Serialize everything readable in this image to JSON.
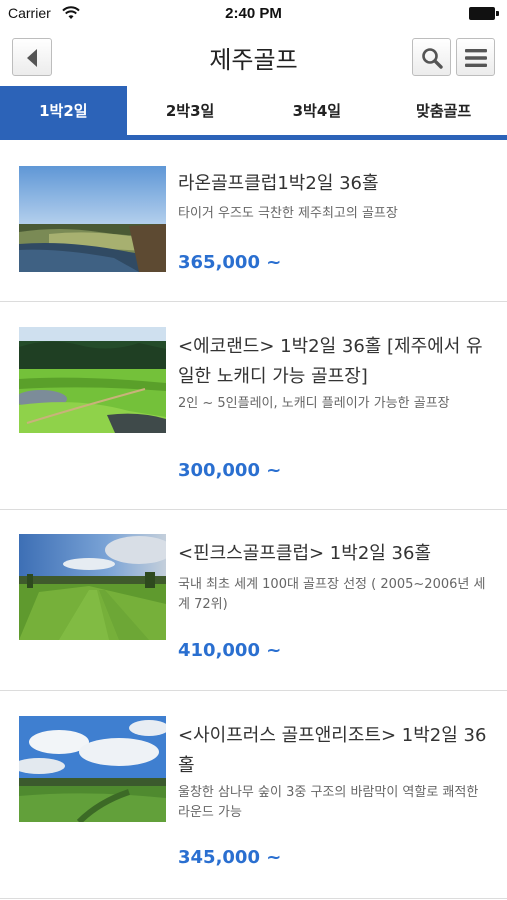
{
  "status_bar": {
    "carrier": "Carrier",
    "time": "2:40 PM"
  },
  "nav": {
    "title": "제주골프",
    "back_icon": "chevron-left-icon",
    "search_icon": "search-icon",
    "menu_icon": "hamburger-menu-icon"
  },
  "tabs": [
    {
      "label": "1박2일",
      "active": true
    },
    {
      "label": "2박3일",
      "active": false
    },
    {
      "label": "3박4일",
      "active": false
    },
    {
      "label": "맞춤골프",
      "active": false
    }
  ],
  "colors": {
    "accent": "#2c63b8",
    "price": "#2a6fd0"
  },
  "products": [
    {
      "title": "라온골프클럽1박2일 36홀",
      "description": "타이거 우즈도 극찬한 제주최고의 골프장",
      "price": "365,000 ~"
    },
    {
      "title": "<에코랜드> 1박2일 36홀 [제주에서 유일한 노캐디 가능 골프장]",
      "description": "2인 ~ 5인플레이, 노캐디 플레이가 가능한 골프장",
      "price": "300,000 ~"
    },
    {
      "title": "<핀크스골프클럽> 1박2일 36홀",
      "description": "국내 최초 세계 100대 골프장 선정 ( 2005~2006년 세계 72위)",
      "price": "410,000 ~"
    },
    {
      "title": "<사이프러스 골프앤리조트> 1박2일 36홀",
      "description": "울창한 삼나무 숲이 3중 구조의 바람막이 역할로 쾌적한 라운드 가능",
      "price": "345,000 ~"
    }
  ]
}
